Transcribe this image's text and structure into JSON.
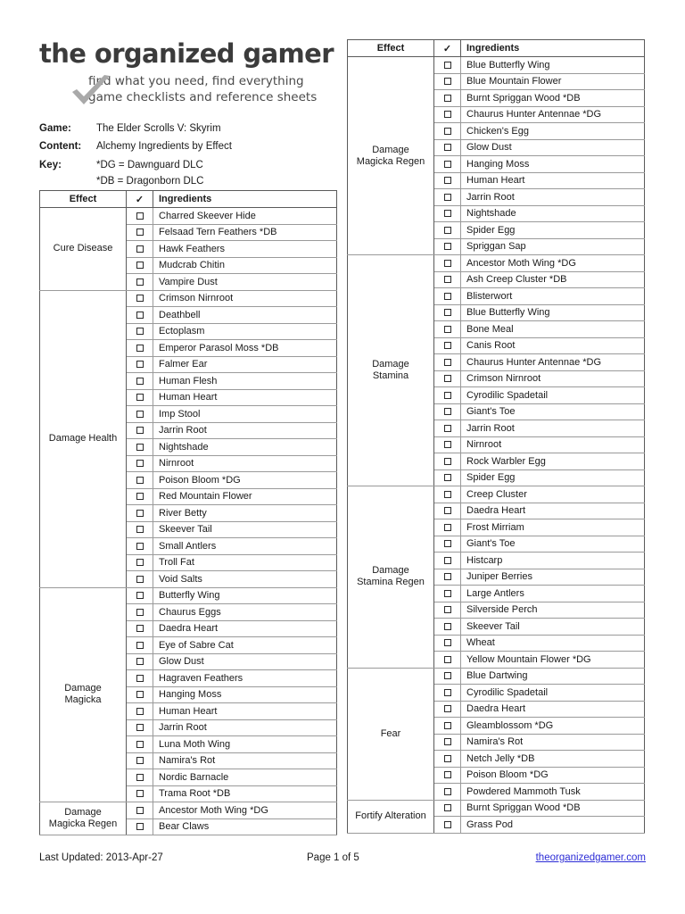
{
  "brand": {
    "title": "the organized gamer",
    "tagline_line1": "find what you need, find everything",
    "tagline_line2": "game checklists and reference sheets",
    "check_icon": "checkmark-icon",
    "check_color": "#a8a8a8"
  },
  "meta": [
    {
      "label": "Game:",
      "value": "The Elder Scrolls V: Skyrim",
      "value2": ""
    },
    {
      "label": "Content:",
      "value": "Alchemy Ingredients by Effect",
      "value2": ""
    },
    {
      "label": "Key:",
      "value": "*DG = Dawnguard DLC",
      "value2": "*DB = Dragonborn DLC"
    }
  ],
  "table_headers": {
    "effect": "Effect",
    "check": "✓",
    "ingredients": "Ingredients"
  },
  "left_table": {
    "groups": [
      {
        "effect": "Cure Disease",
        "effect_lines": [
          "Cure Disease"
        ],
        "ingredients": [
          "Charred Skeever Hide",
          "Felsaad Tern Feathers *DB",
          "Hawk Feathers",
          "Mudcrab Chitin",
          "Vampire Dust"
        ]
      },
      {
        "effect": "Damage Health",
        "effect_lines": [
          "Damage Health"
        ],
        "ingredients": [
          "Crimson Nirnroot",
          "Deathbell",
          "Ectoplasm",
          "Emperor Parasol Moss *DB",
          "Falmer Ear",
          "Human Flesh",
          "Human Heart",
          "Imp Stool",
          "Jarrin Root",
          "Nightshade",
          "Nirnroot",
          "Poison Bloom *DG",
          "Red Mountain Flower",
          "River Betty",
          "Skeever Tail",
          "Small Antlers",
          "Troll Fat",
          "Void Salts"
        ]
      },
      {
        "effect": "Damage Magicka",
        "effect_lines": [
          "Damage",
          "Magicka"
        ],
        "ingredients": [
          "Butterfly Wing",
          "Chaurus Eggs",
          "Daedra Heart",
          "Eye of Sabre Cat",
          "Glow Dust",
          "Hagraven Feathers",
          "Hanging Moss",
          "Human Heart",
          "Jarrin Root",
          "Luna Moth Wing",
          "Namira's Rot",
          "Nordic Barnacle",
          "Trama Root *DB"
        ]
      },
      {
        "effect": "Damage Magicka Regen",
        "effect_lines": [
          "Damage",
          "Magicka Regen"
        ],
        "ingredients": [
          "Ancestor Moth Wing *DG",
          "Bear Claws"
        ]
      }
    ]
  },
  "right_table": {
    "groups": [
      {
        "effect": "Damage Magicka Regen",
        "effect_lines": [
          "Damage",
          "Magicka Regen"
        ],
        "ingredients": [
          "Blue Butterfly Wing",
          "Blue Mountain Flower",
          "Burnt Spriggan Wood *DB",
          "Chaurus Hunter Antennae *DG",
          "Chicken's Egg",
          "Glow Dust",
          "Hanging Moss",
          "Human Heart",
          "Jarrin Root",
          "Nightshade",
          "Spider Egg",
          "Spriggan Sap"
        ]
      },
      {
        "effect": "Damage Stamina",
        "effect_lines": [
          "Damage",
          "Stamina"
        ],
        "ingredients": [
          "Ancestor Moth Wing *DG",
          "Ash Creep Cluster *DB",
          "Blisterwort",
          "Blue Butterfly Wing",
          "Bone Meal",
          "Canis Root",
          "Chaurus Hunter Antennae *DG",
          "Crimson Nirnroot",
          "Cyrodilic Spadetail",
          "Giant's Toe",
          "Jarrin Root",
          "Nirnroot",
          "Rock Warbler Egg",
          "Spider Egg"
        ]
      },
      {
        "effect": "Damage Stamina Regen",
        "effect_lines": [
          "Damage",
          "Stamina Regen"
        ],
        "ingredients": [
          "Creep Cluster",
          "Daedra Heart",
          "Frost Mirriam",
          "Giant's Toe",
          "Histcarp",
          "Juniper Berries",
          "Large Antlers",
          "Silverside Perch",
          "Skeever Tail",
          "Wheat",
          "Yellow Mountain Flower *DG"
        ]
      },
      {
        "effect": "Fear",
        "effect_lines": [
          "Fear"
        ],
        "ingredients": [
          "Blue Dartwing",
          "Cyrodilic Spadetail",
          "Daedra Heart",
          "Gleamblossom *DG",
          "Namira's Rot",
          "Netch Jelly *DB",
          "Poison Bloom *DG",
          "Powdered Mammoth Tusk"
        ]
      },
      {
        "effect": "Fortify Alteration",
        "effect_lines": [
          "Fortify Alteration"
        ],
        "ingredients": [
          "Burnt Spriggan Wood *DB",
          "Grass Pod"
        ]
      }
    ]
  },
  "footer": {
    "last_updated": "Last Updated: 2013-Apr-27",
    "page": "Page 1 of 5",
    "website": "theorganizedgamer.com",
    "link_color": "#2c2cd6"
  }
}
